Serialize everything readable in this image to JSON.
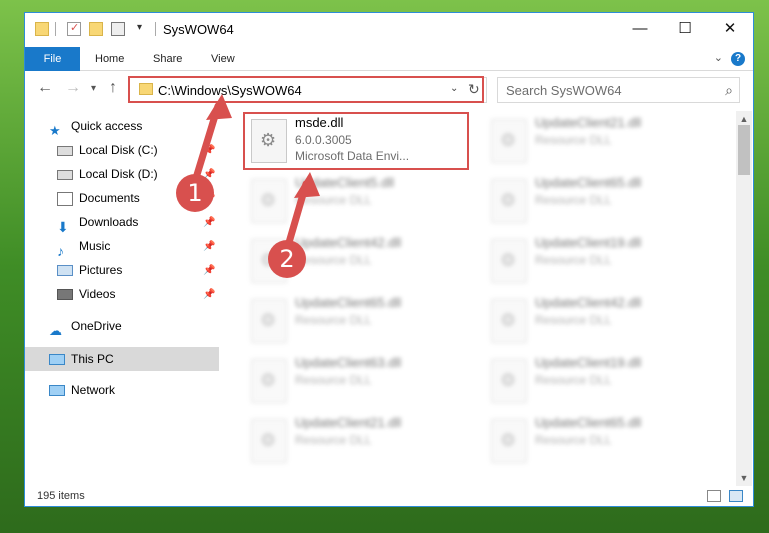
{
  "window": {
    "title": "SysWOW64",
    "controls": [
      "—",
      "☐",
      "✕"
    ]
  },
  "ribbon": {
    "tabs": [
      "File",
      "Home",
      "Share",
      "View"
    ],
    "help": "?"
  },
  "address": {
    "path": "C:\\Windows\\SysWOW64",
    "search_placeholder": "Search SysWOW64"
  },
  "navpane": {
    "items": [
      {
        "label": "Quick access",
        "icon": "star-icon",
        "pinned": false
      },
      {
        "label": "Local Disk (C:)",
        "icon": "drive-icon",
        "pinned": true
      },
      {
        "label": "Local Disk (D:)",
        "icon": "drive-icon",
        "pinned": true
      },
      {
        "label": "Documents",
        "icon": "documents-icon",
        "pinned": true
      },
      {
        "label": "Downloads",
        "icon": "download-icon",
        "pinned": true
      },
      {
        "label": "Music",
        "icon": "music-icon",
        "pinned": true
      },
      {
        "label": "Pictures",
        "icon": "pictures-icon",
        "pinned": true
      },
      {
        "label": "Videos",
        "icon": "videos-icon",
        "pinned": true
      },
      {
        "label": "OneDrive",
        "icon": "cloud-icon"
      },
      {
        "label": "This PC",
        "icon": "computer-icon",
        "selected": true
      },
      {
        "label": "Network",
        "icon": "network-icon"
      }
    ]
  },
  "files": [
    {
      "name": "msde.dll",
      "line1": "6.0.0.3005",
      "line2": "Microsoft Data Envi...",
      "highlighted": true
    },
    {
      "name": "UpdateClient21.dll",
      "line1": "Resource DLL"
    },
    {
      "name": "UpdateClient5.dll",
      "line1": "Resource DLL"
    },
    {
      "name": "UpdateClient65.dll",
      "line1": "Resource DLL"
    },
    {
      "name": "UpdateClient42.dll",
      "line1": "Resource DLL"
    },
    {
      "name": "UpdateClient19.dll",
      "line1": "Resource DLL"
    },
    {
      "name": "UpdateClient65.dll",
      "line1": "Resource DLL"
    },
    {
      "name": "UpdateClient42.dll",
      "line1": "Resource DLL"
    },
    {
      "name": "UpdateClient63.dll",
      "line1": "Resource DLL"
    },
    {
      "name": "UpdateClient19.dll",
      "line1": "Resource DLL"
    },
    {
      "name": "UpdateClient21.dll",
      "line1": "Resource DLL"
    },
    {
      "name": "UpdateClient65.dll",
      "line1": "Resource DLL"
    }
  ],
  "status": {
    "item_count": "195 items"
  },
  "annotations": {
    "step1": "1",
    "step2": "2",
    "color": "#d8504e"
  }
}
